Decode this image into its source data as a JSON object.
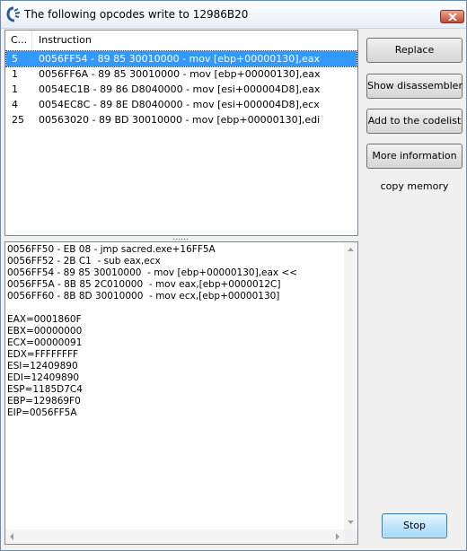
{
  "window": {
    "title": "The following opcodes write to 12986B20"
  },
  "list": {
    "columns": [
      "C...",
      "Instruction"
    ],
    "rows": [
      {
        "count": "5",
        "instruction": "0056FF54 - 89 85 30010000  - mov [ebp+00000130],eax"
      },
      {
        "count": "1",
        "instruction": "0056FF6A - 89 85 30010000  - mov [ebp+00000130],eax"
      },
      {
        "count": "1",
        "instruction": "0054EC1B - 89 86 D8040000  - mov [esi+000004D8],eax"
      },
      {
        "count": "4",
        "instruction": "0054EC8C - 89 8E D8040000  - mov [esi+000004D8],ecx"
      },
      {
        "count": "25",
        "instruction": "00563020 - 89 BD 30010000  - mov [ebp+00000130],edi"
      }
    ],
    "selected_index": 0
  },
  "details": {
    "text": "0056FF50 - EB 08 - jmp sacred.exe+16FF5A\n0056FF52 - 2B C1  - sub eax,ecx\n0056FF54 - 89 85 30010000  - mov [ebp+00000130],eax <<\n0056FF5A - 8B 85 2C010000  - mov eax,[ebp+0000012C]\n0056FF60 - 8B 8D 30010000  - mov ecx,[ebp+00000130]\n\nEAX=0001860F\nEBX=00000000\nECX=00000091\nEDX=FFFFFFFF\nESI=12409890\nEDI=12409890\nESP=1185D7C4\nEBP=129869F0\nEIP=0056FF5A"
  },
  "buttons": {
    "replace": "Replace",
    "show_disassembler": "Show disassembler",
    "add_to_codelist": "Add to the codelist",
    "more_information": "More information",
    "copy_memory": "copy memory",
    "stop": "Stop"
  },
  "colors": {
    "selection": "#3399ff",
    "stop_button": "#bee6fd",
    "close_button": "#c24a33"
  },
  "icons": {
    "app": "cheat-engine-icon",
    "close": "close-icon"
  }
}
